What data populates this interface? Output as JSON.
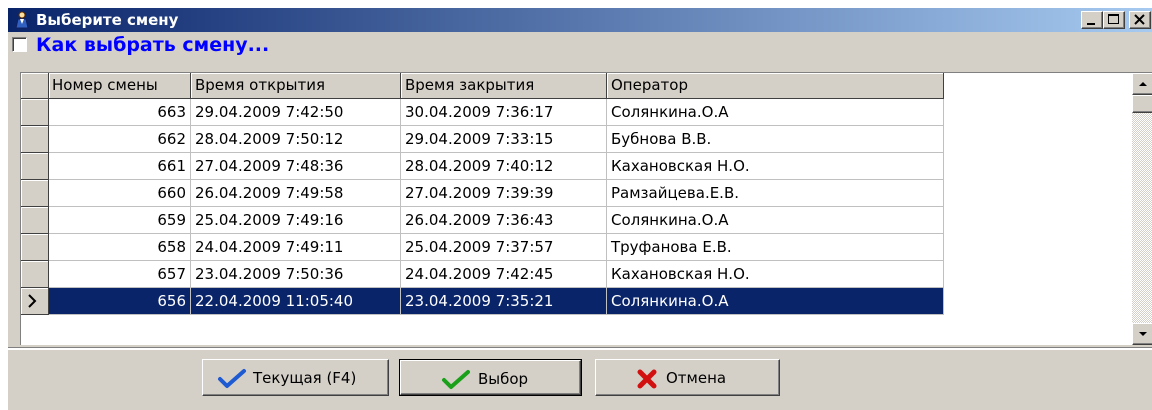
{
  "window": {
    "title": "Выберите смену"
  },
  "help": {
    "link_text": "Как выбрать смену...",
    "checked": false
  },
  "grid": {
    "columns": [
      "Номер смены",
      "Время открытия",
      "Время закрытия",
      "Оператор"
    ],
    "rows": [
      {
        "number": "663",
        "opened": "29.04.2009 7:42:50",
        "closed": "30.04.2009 7:36:17",
        "operator": "Солянкина.О.А"
      },
      {
        "number": "662",
        "opened": "28.04.2009 7:50:12",
        "closed": "29.04.2009 7:33:15",
        "operator": "Бубнова В.В."
      },
      {
        "number": "661",
        "opened": "27.04.2009 7:48:36",
        "closed": "28.04.2009 7:40:12",
        "operator": "Кахановская Н.О."
      },
      {
        "number": "660",
        "opened": "26.04.2009 7:49:58",
        "closed": "27.04.2009 7:39:39",
        "operator": "Рамзайцева.Е.В."
      },
      {
        "number": "659",
        "opened": "25.04.2009 7:49:16",
        "closed": "26.04.2009 7:36:43",
        "operator": "Солянкина.О.А"
      },
      {
        "number": "658",
        "opened": "24.04.2009 7:49:11",
        "closed": "25.04.2009 7:37:57",
        "operator": "Труфанова Е.В."
      },
      {
        "number": "657",
        "opened": "23.04.2009 7:50:36",
        "closed": "24.04.2009 7:42:45",
        "operator": "Кахановская Н.О."
      },
      {
        "number": "656",
        "opened": "22.04.2009 11:05:40",
        "closed": "23.04.2009 7:35:21",
        "operator": "Солянкина.О.А",
        "selected": true
      }
    ]
  },
  "buttons": {
    "current": {
      "label": "Текущая (F4)",
      "icon": "checkmark-blue-icon"
    },
    "select": {
      "label": "Выбор",
      "icon": "checkmark-green-icon"
    },
    "cancel": {
      "label": "Отмена",
      "icon": "cross-red-icon"
    }
  },
  "colors": {
    "title_bar": "#0a246a",
    "selection": "#0a246a",
    "link": "#0000ff",
    "face": "#d4d0c8"
  }
}
